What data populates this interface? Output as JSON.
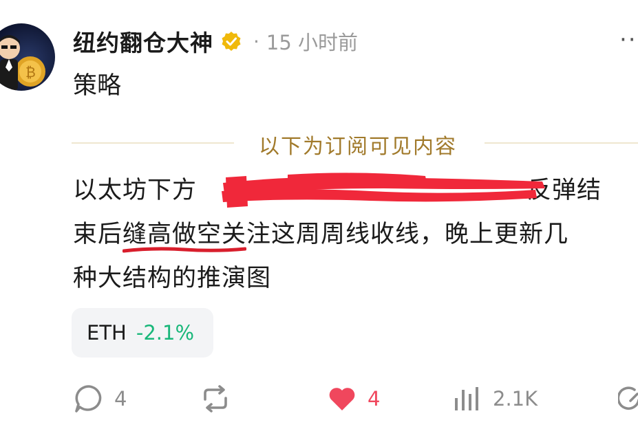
{
  "post": {
    "author": "纽约翻仓大神",
    "separator": "·",
    "time": "15 小时前",
    "more": "··",
    "title": "策略",
    "subscriber_notice": "以下为订阅可见内容",
    "body_lines": [
      {
        "before": "以太坊下方",
        "after": "反弹结"
      },
      {
        "before": "束后",
        "underlined": "缝高做空关",
        "after": "注这周周线收线，晚上更新几"
      },
      {
        "text": "种大结构的推演图"
      }
    ],
    "ticker": {
      "symbol": "ETH",
      "change": "-2.1%",
      "change_color": "#19b77a"
    },
    "actions": {
      "comments": "4",
      "likes": "4",
      "views": "2.1K"
    }
  },
  "colors": {
    "accent_gold": "#a17a2b",
    "like_red": "#f0475d",
    "redaction_red": "#f0283a"
  }
}
